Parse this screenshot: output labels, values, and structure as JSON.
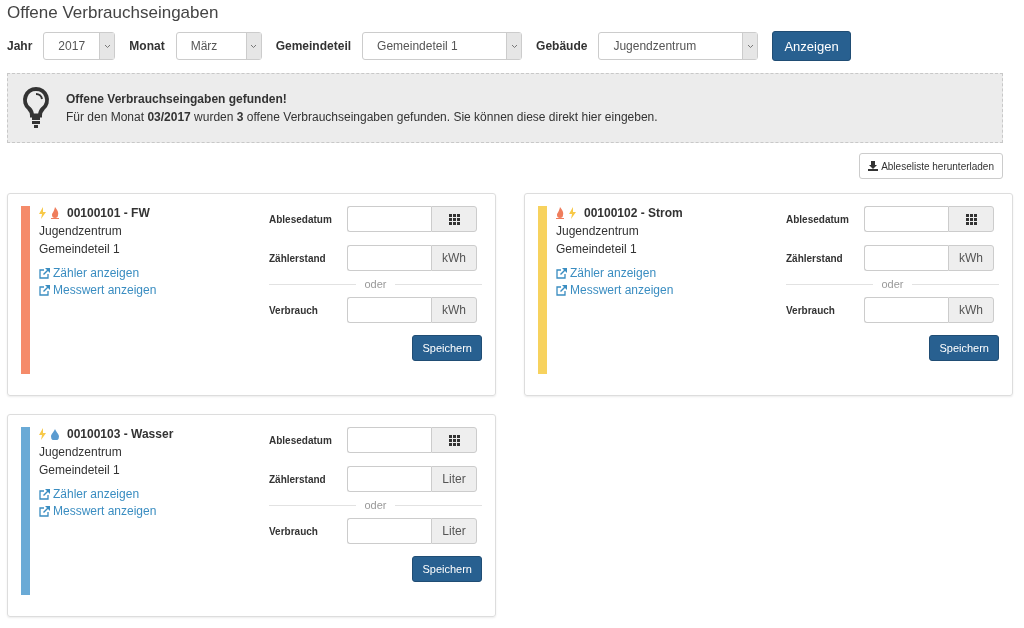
{
  "page_title": "Offene Verbrauchseingaben",
  "filters": [
    {
      "label": "Jahr",
      "value": "2017"
    },
    {
      "label": "Monat",
      "value": "März"
    },
    {
      "label": "Gemeindeteil",
      "value": "Gemeindeteil 1"
    },
    {
      "label": "Gebäude",
      "value": "Jugendzentrum"
    }
  ],
  "show_button": "Anzeigen",
  "alert": {
    "title": "Offene Verbrauchseingaben gefunden!",
    "text": "Für den Monat **03/2017** wurden **3** offene Verbrauchseingaben gefunden. Sie können diese direkt hier eingeben."
  },
  "download_button": "Ableseliste herunterladen",
  "meters": [
    {
      "color": "#f58b6a",
      "icons": [
        {
          "kind": "bolt"
        },
        {
          "kind": "flame"
        }
      ],
      "title": "00100101 - FW",
      "building": "Jugendzentrum",
      "district": "Gemeindeteil 1",
      "links": [
        "Zähler anzeigen",
        "Messwert anzeigen"
      ],
      "date_label": "Ablesedatum",
      "reading_label": "Zählerstand",
      "reading_unit": "kWh",
      "separator": "oder",
      "usage_label": "Verbrauch",
      "usage_unit": "kWh",
      "save": "Speichern"
    },
    {
      "color": "#f7d25e",
      "icons": [
        {
          "kind": "flame"
        },
        {
          "kind": "bolt"
        }
      ],
      "title": "00100102 - Strom",
      "building": "Jugendzentrum",
      "district": "Gemeindeteil 1",
      "links": [
        "Zähler anzeigen",
        "Messwert anzeigen"
      ],
      "date_label": "Ablesedatum",
      "reading_label": "Zählerstand",
      "reading_unit": "kWh",
      "separator": "oder",
      "usage_label": "Verbrauch",
      "usage_unit": "kWh",
      "save": "Speichern"
    },
    {
      "color": "#6aaad6",
      "icons": [
        {
          "kind": "bolt"
        },
        {
          "kind": "drop"
        }
      ],
      "title": "00100103 - Wasser",
      "building": "Jugendzentrum",
      "district": "Gemeindeteil 1",
      "links": [
        "Zähler anzeigen",
        "Messwert anzeigen"
      ],
      "date_label": "Ablesedatum",
      "reading_label": "Zählerstand",
      "reading_unit": "Liter",
      "separator": "oder",
      "usage_label": "Verbrauch",
      "usage_unit": "Liter",
      "save": "Speichern"
    }
  ]
}
